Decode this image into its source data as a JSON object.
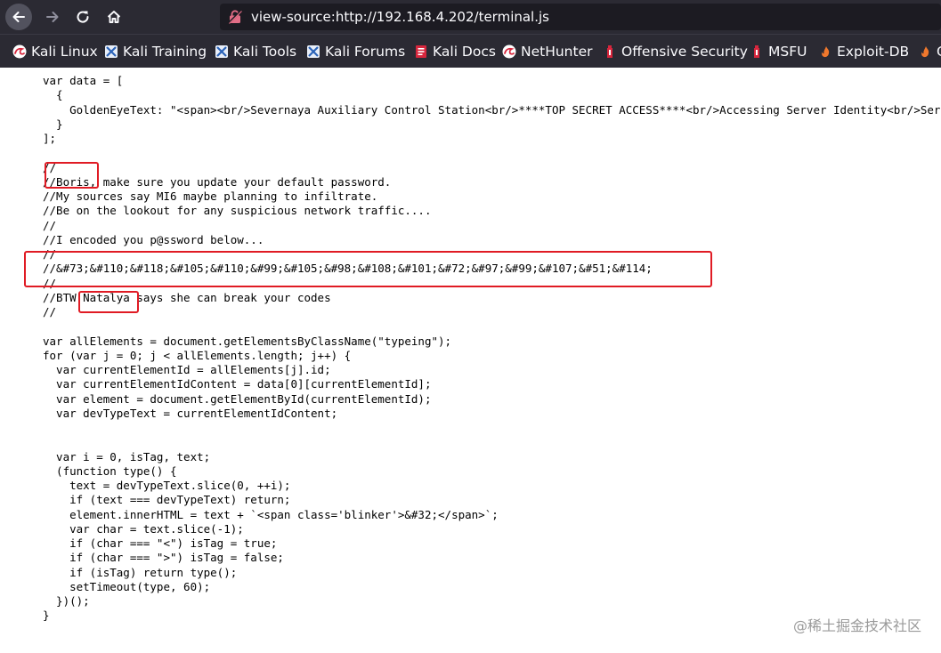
{
  "browser": {
    "url": "view-source:http://192.168.4.202/terminal.js",
    "bookmarks": [
      {
        "label": "Kali Linux",
        "icon": "kali-dragon-icon"
      },
      {
        "label": "Kali Training",
        "icon": "kali-training-icon"
      },
      {
        "label": "Kali Tools",
        "icon": "kali-tools-icon"
      },
      {
        "label": "Kali Forums",
        "icon": "kali-forums-icon"
      },
      {
        "label": "Kali Docs",
        "icon": "kali-docs-icon"
      },
      {
        "label": "NetHunter",
        "icon": "nethunter-icon"
      },
      {
        "label": "Offensive Security",
        "icon": "offensive-security-icon"
      },
      {
        "label": "MSFU",
        "icon": "msfu-icon"
      },
      {
        "label": "Exploit-DB",
        "icon": "exploit-db-icon"
      },
      {
        "label": "G",
        "icon": "ghdb-icon"
      }
    ]
  },
  "source": {
    "lines": [
      "var data = [",
      "  {",
      "    GoldenEyeText: \"<span><br/>Severnaya Auxiliary Control Station<br/>****TOP SECRET ACCESS****<br/>Accessing Server Identity<br/>Server Name:....................<br/>GOLDENEYE<br/><br/>\"",
      "  }",
      "];",
      "",
      "//",
      "//Boris, make sure you update your default password.",
      "//My sources say MI6 maybe planning to infiltrate.",
      "//Be on the lookout for any suspicious network traffic....",
      "//",
      "//I encoded you p@ssword below...",
      "//",
      "//&#73;&#110;&#118;&#105;&#110;&#99;&#105;&#98;&#108;&#101;&#72;&#97;&#99;&#107;&#51;&#114;",
      "//",
      "//BTW Natalya says she can break your codes",
      "//",
      "",
      "var allElements = document.getElementsByClassName(\"typeing\");",
      "for (var j = 0; j < allElements.length; j++) {",
      "  var currentElementId = allElements[j].id;",
      "  var currentElementIdContent = data[0][currentElementId];",
      "  var element = document.getElementById(currentElementId);",
      "  var devTypeText = currentElementIdContent;",
      "",
      "",
      "  var i = 0, isTag, text;",
      "  (function type() {",
      "    text = devTypeText.slice(0, ++i);",
      "    if (text === devTypeText) return;",
      "    element.innerHTML = text + `<span class='blinker'>&#32;</span>`;",
      "    var char = text.slice(-1);",
      "    if (char === \"<\") isTag = true;",
      "    if (char === \">\") isTag = false;",
      "    if (isTag) return type();",
      "    setTimeout(type, 60);",
      "  })();",
      "}"
    ]
  },
  "watermark": "@稀土掘金技术社区",
  "colors": {
    "toolbar": "#2b2a33",
    "urlbar": "#1c1b22",
    "text_light": "#fbfbfe",
    "highlight": "#e01b24"
  }
}
